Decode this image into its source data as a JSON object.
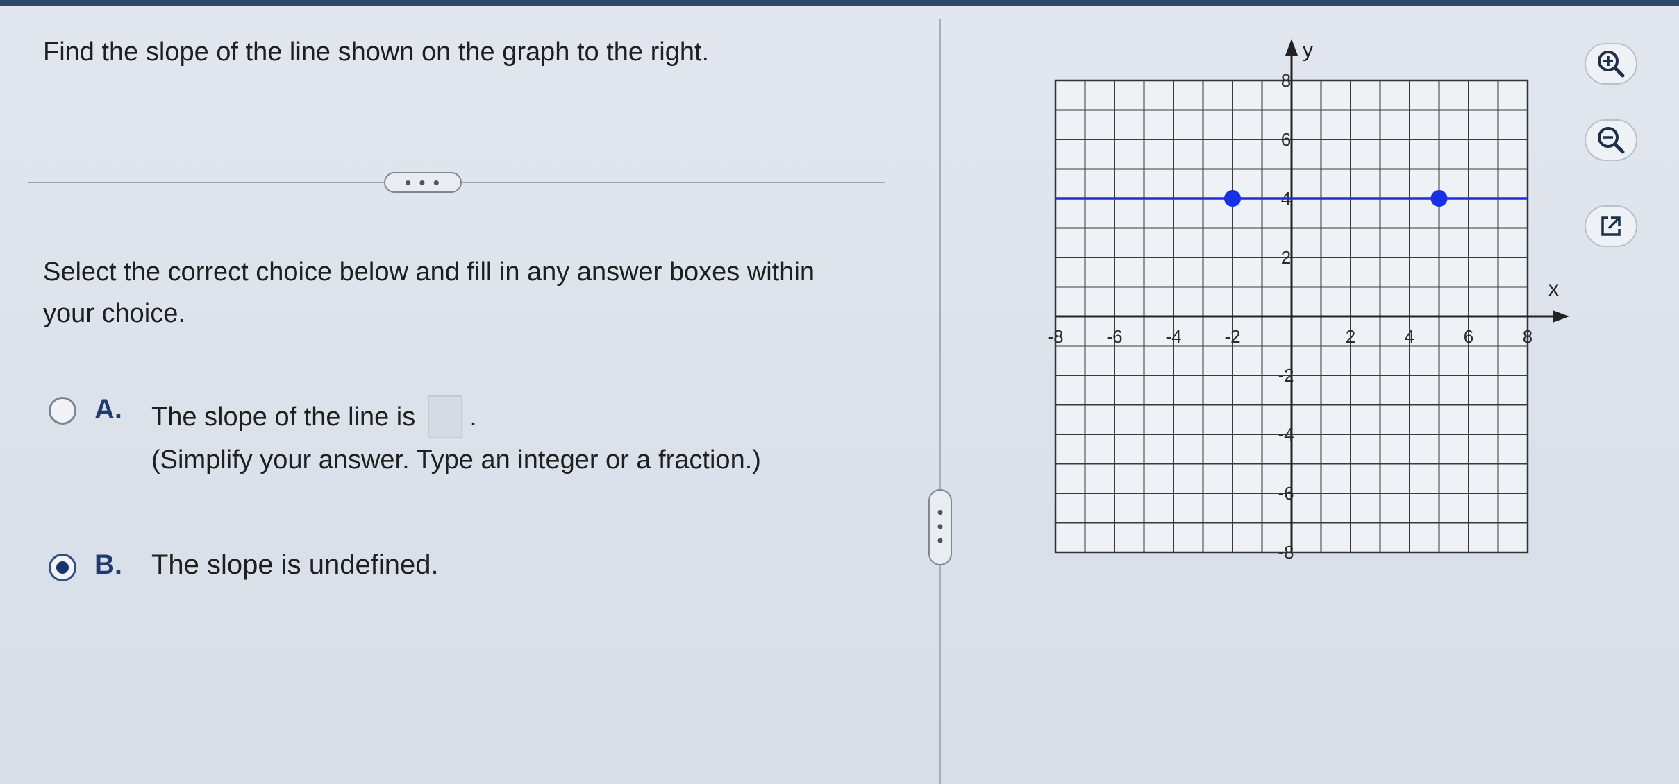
{
  "question": {
    "prompt": "Find the slope of the line shown on the graph to the right.",
    "more_label": "• • •",
    "instructions": "Select the correct choice below and fill in any answer boxes within your choice."
  },
  "choices": {
    "a": {
      "letter": "A.",
      "text": "The slope of the line is",
      "answer_value": "",
      "period": ".",
      "note": "(Simplify your answer. Type an integer or a fraction.)",
      "selected": false
    },
    "b": {
      "letter": "B.",
      "text": "The slope is undefined.",
      "selected": true
    }
  },
  "splitter": {
    "handle_label": "• • •"
  },
  "tools": [
    {
      "name": "zoom-in-icon"
    },
    {
      "name": "zoom-out-icon"
    },
    {
      "name": "popout-icon"
    }
  ],
  "colors": {
    "line": "#1d2fd6",
    "point": "#1630e6",
    "choice_letter": "#1f3b6f",
    "selected_radio": "#17336b"
  },
  "chart_data": {
    "type": "line",
    "title": "",
    "xlabel": "x",
    "ylabel": "y",
    "xlim": [
      -8,
      8
    ],
    "ylim": [
      -8,
      8
    ],
    "grid": true,
    "x_ticks": [
      -8,
      -6,
      -4,
      -2,
      2,
      4,
      6,
      8
    ],
    "y_ticks": [
      8,
      6,
      4,
      2,
      -2,
      -4,
      -6,
      -8
    ],
    "series": [
      {
        "x": [
          -8,
          8
        ],
        "y": [
          4,
          4
        ],
        "points": [
          {
            "x": -2,
            "y": 4
          },
          {
            "x": 5,
            "y": 4
          }
        ]
      }
    ]
  }
}
